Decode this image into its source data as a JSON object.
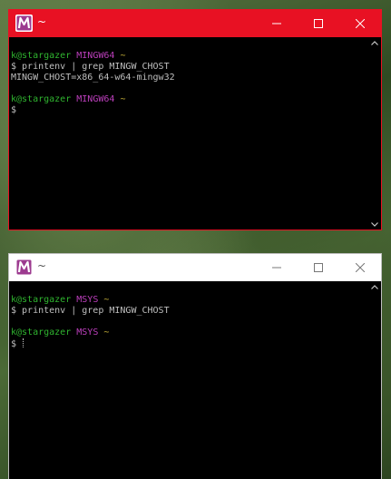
{
  "windows": [
    {
      "title": "~",
      "icon": "msys2-m-icon",
      "controls": [
        "minimize-icon",
        "maximize-icon",
        "close-icon"
      ],
      "prompt1": {
        "user_host": "k@stargazer",
        "system": "MINGW64",
        "path": "~"
      },
      "command_line": "$ printenv | grep MINGW_CHOST",
      "output_line": "MINGW_CHOST=x86_64-w64-mingw32",
      "prompt2": {
        "user_host": "k@stargazer",
        "system": "MINGW64",
        "path": "~"
      },
      "last_line": "$"
    },
    {
      "title": "~",
      "icon": "msys2-m-icon",
      "controls": [
        "minimize-icon",
        "maximize-icon",
        "close-icon"
      ],
      "prompt1": {
        "user_host": "k@stargazer",
        "system": "MSYS",
        "path": "~"
      },
      "command_line": "$ printenv | grep MINGW_CHOST",
      "prompt2": {
        "user_host": "k@stargazer",
        "system": "MSYS",
        "path": "~"
      },
      "last_line": "$"
    }
  ],
  "colors": {
    "active_titlebar": "#e81123",
    "inactive_titlebar": "#ffffff",
    "user_host": "#2fb42f",
    "system": "#bc3fbc",
    "path": "#c8b23a",
    "terminal_text": "#bfbfbf",
    "terminal_bg": "#000000"
  }
}
